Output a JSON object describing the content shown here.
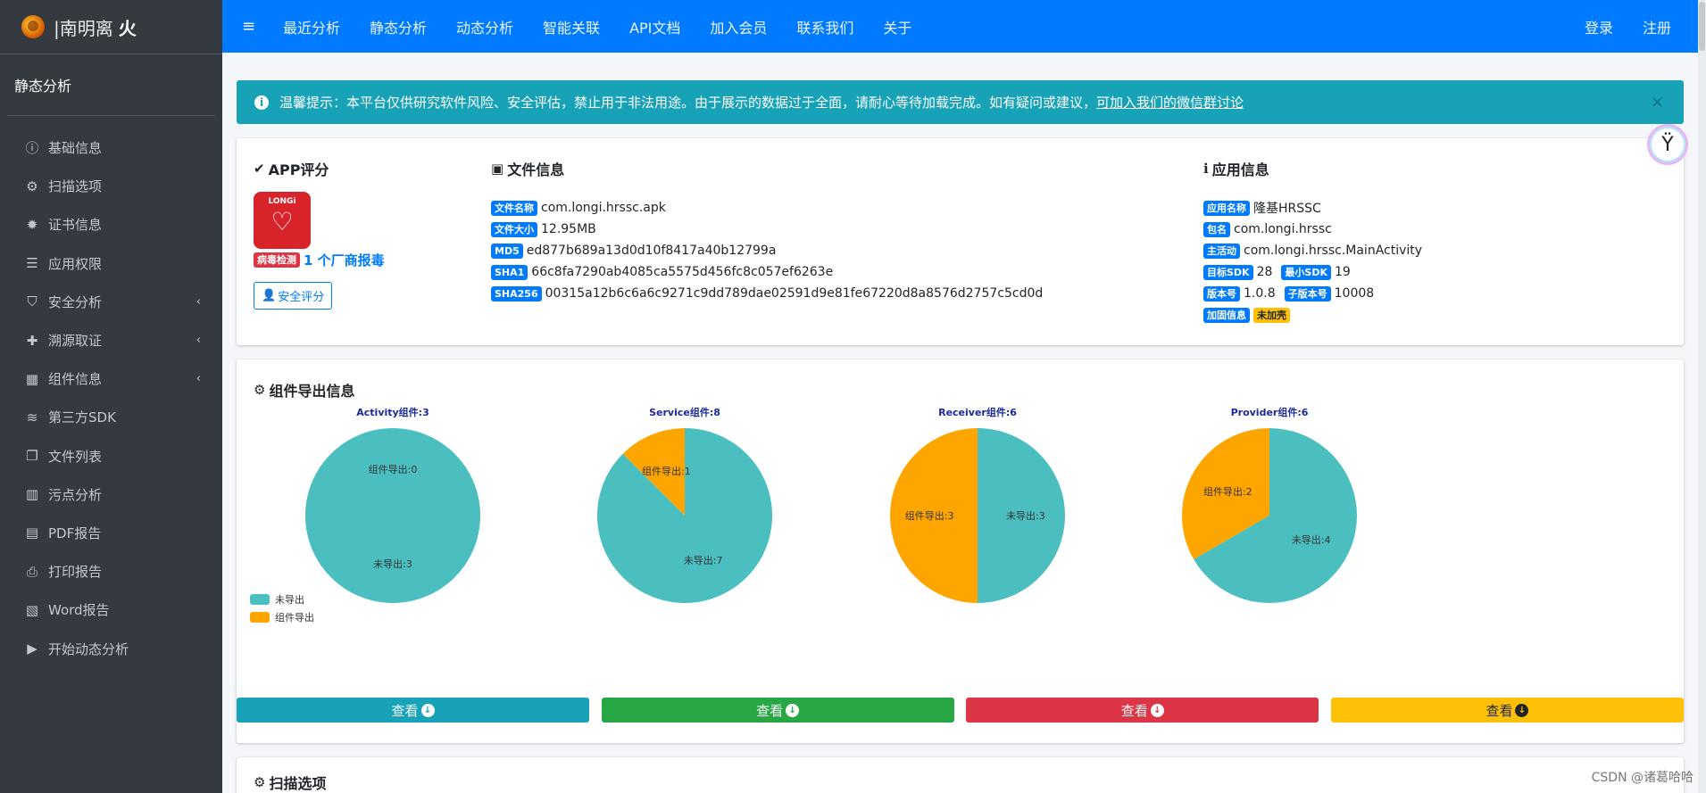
{
  "brand": {
    "prefix": "|南明离",
    "bold": "火"
  },
  "sidebar": {
    "section": "静态分析",
    "items": [
      {
        "label": "基础信息",
        "icon": "ⓘ",
        "arrow": ""
      },
      {
        "label": "扫描选项",
        "icon": "⚙",
        "arrow": ""
      },
      {
        "label": "证书信息",
        "icon": "✹",
        "arrow": ""
      },
      {
        "label": "应用权限",
        "icon": "☰",
        "arrow": ""
      },
      {
        "label": "安全分析",
        "icon": "⛉",
        "arrow": "‹"
      },
      {
        "label": "溯源取证",
        "icon": "✚",
        "arrow": "‹"
      },
      {
        "label": "组件信息",
        "icon": "▦",
        "arrow": "‹"
      },
      {
        "label": "第三方SDK",
        "icon": "≋",
        "arrow": ""
      },
      {
        "label": "文件列表",
        "icon": "❐",
        "arrow": ""
      },
      {
        "label": "污点分析",
        "icon": "▥",
        "arrow": ""
      },
      {
        "label": "PDF报告",
        "icon": "▤",
        "arrow": ""
      },
      {
        "label": "打印报告",
        "icon": "⎙",
        "arrow": ""
      },
      {
        "label": "Word报告",
        "icon": "▧",
        "arrow": ""
      },
      {
        "label": "开始动态分析",
        "icon": "▶",
        "arrow": ""
      }
    ]
  },
  "topbar": {
    "menu_icon": "≡",
    "links": [
      "最近分析",
      "静态分析",
      "动态分析",
      "智能关联",
      "API文档",
      "加入会员",
      "联系我们",
      "关于"
    ],
    "right": [
      "登录",
      "注册"
    ]
  },
  "alert": {
    "text": "温馨提示：本平台仅供研究软件风险、安全评估，禁止用于非法用途。由于展示的数据过于全面，请耐心等待加载完成。如有疑问或建议，",
    "link": "可加入我们的微信群讨论",
    "close": "×"
  },
  "app_score": {
    "title": "APP评分",
    "logo_text": "LONGi",
    "virus_badge": "病毒检测",
    "virus_text": "1 个厂商报毒",
    "score_button": "安全评分"
  },
  "file_info": {
    "title": "文件信息",
    "rows": [
      {
        "label": "文件名称",
        "value": "com.longi.hrssc.apk"
      },
      {
        "label": "文件大小",
        "value": "12.95MB"
      },
      {
        "label": "MD5",
        "value": "ed877b689a13d0d10f8417a40b12799a"
      },
      {
        "label": "SHA1",
        "value": "66c8fa7290ab4085ca5575d456fc8c057ef6263e"
      },
      {
        "label": "SHA256",
        "value": "00315a12b6c6a6c9271c9dd789dae02591d9e81fe67220d8a8576d2757c5cd0d"
      }
    ]
  },
  "app_info": {
    "title": "应用信息",
    "app_name_label": "应用名称",
    "app_name": "隆基HRSSC",
    "package_label": "包名",
    "package": "com.longi.hrssc",
    "main_label": "主活动",
    "main": "com.longi.hrssc.MainActivity",
    "target_sdk_label": "目标SDK",
    "target_sdk": "28",
    "min_sdk_label": "最小SDK",
    "min_sdk": "19",
    "version_label": "版本号",
    "version": "1.0.8",
    "sub_version_label": "子版本号",
    "sub_version": "10008",
    "harden_label": "加固信息",
    "harden": "未加壳"
  },
  "components": {
    "title": "组件导出信息",
    "view_label": "查看",
    "legend": [
      "未导出",
      "组件导出"
    ]
  },
  "chart_data": {
    "type": "pie",
    "colors": {
      "未导出": "#4bbfbf",
      "组件导出": "#ffa500"
    },
    "charts": [
      {
        "title": "Activity组件:3",
        "slices": [
          {
            "name": "组件导出",
            "label": "组件导出:0",
            "value": 0
          },
          {
            "name": "未导出",
            "label": "未导出:3",
            "value": 3
          }
        ]
      },
      {
        "title": "Service组件:8",
        "slices": [
          {
            "name": "组件导出",
            "label": "组件导出:1",
            "value": 1
          },
          {
            "name": "未导出",
            "label": "未导出:7",
            "value": 7
          }
        ]
      },
      {
        "title": "Receiver组件:6",
        "slices": [
          {
            "name": "组件导出",
            "label": "组件导出:3",
            "value": 3
          },
          {
            "name": "未导出",
            "label": "未导出:3",
            "value": 3
          }
        ]
      },
      {
        "title": "Provider组件:6",
        "slices": [
          {
            "name": "组件导出",
            "label": "组件导出:2",
            "value": 2
          },
          {
            "name": "未导出",
            "label": "未导出:4",
            "value": 4
          }
        ]
      }
    ]
  },
  "scan_options": {
    "title": "扫描选项"
  },
  "watermark": "CSDN @诸葛哈哈"
}
